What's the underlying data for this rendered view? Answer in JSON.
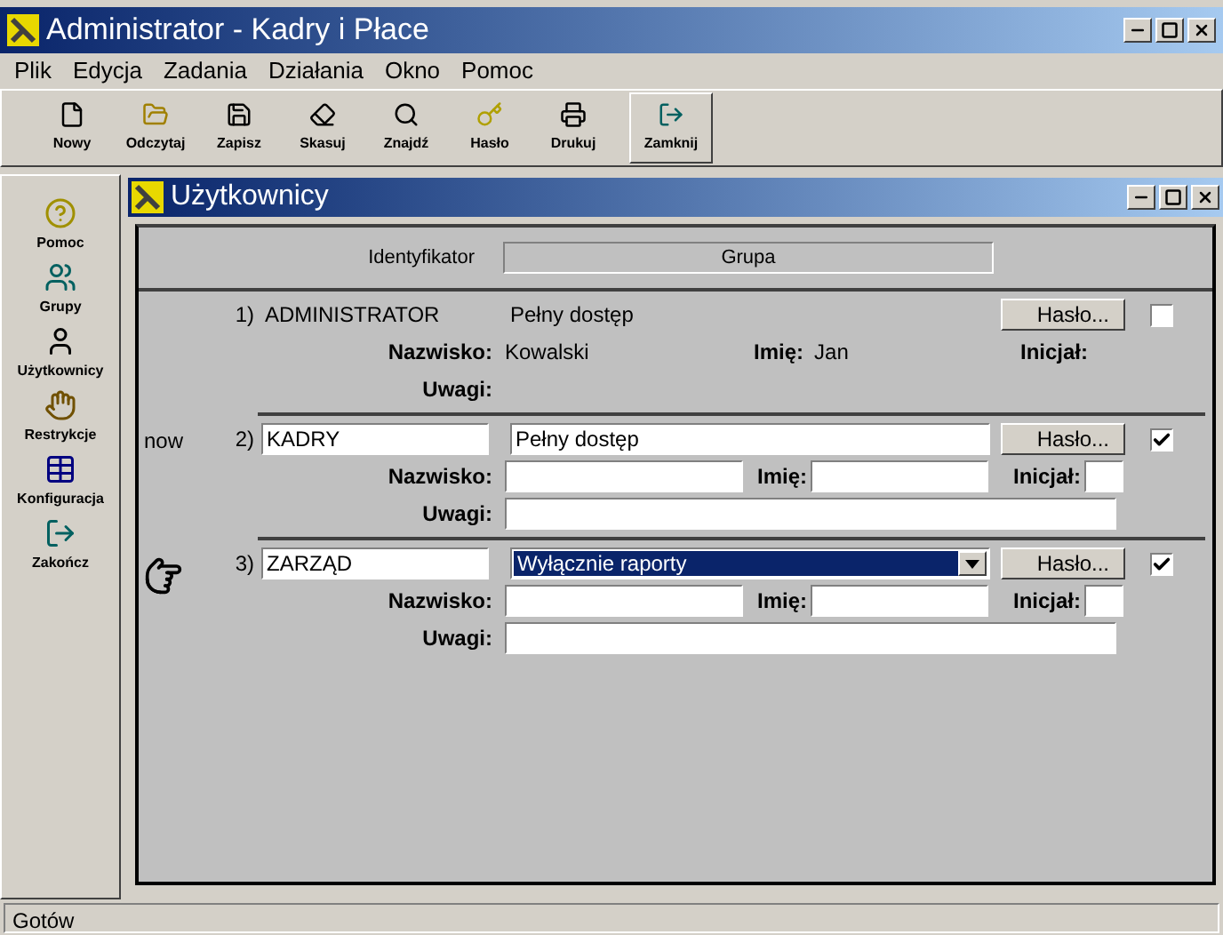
{
  "window": {
    "title": "Administrator - Kadry i Płace"
  },
  "menu": [
    "Plik",
    "Edycja",
    "Zadania",
    "Działania",
    "Okno",
    "Pomoc"
  ],
  "toolbar": [
    {
      "label": "Nowy",
      "kind": "new"
    },
    {
      "label": "Odczytaj",
      "kind": "open"
    },
    {
      "label": "Zapisz",
      "kind": "save"
    },
    {
      "label": "Skasuj",
      "kind": "erase"
    },
    {
      "label": "Znajdź",
      "kind": "find"
    },
    {
      "label": "Hasło",
      "kind": "key"
    },
    {
      "label": "Drukuj",
      "kind": "print"
    },
    {
      "label": "Zamknij",
      "kind": "exit"
    }
  ],
  "sidebar": [
    {
      "label": "Pomoc",
      "kind": "help"
    },
    {
      "label": "Grupy",
      "kind": "groups"
    },
    {
      "label": "Użytkownicy",
      "kind": "users"
    },
    {
      "label": "Restrykcje",
      "kind": "restrict"
    },
    {
      "label": "Konfiguracja",
      "kind": "config"
    },
    {
      "label": "Zakończ",
      "kind": "exit"
    }
  ],
  "child": {
    "title": "Użytkownicy",
    "header": {
      "identifier": "Identyfikator",
      "group": "Grupa"
    },
    "users": [
      {
        "kind": "readonly",
        "current": false,
        "number": "1)",
        "identifier": "ADMINISTRATOR",
        "group": "Pełny dostęp",
        "surname_label": "Nazwisko:",
        "surname": "Kowalski",
        "first_label": "Imię:",
        "first_name": "Jan",
        "initial_label": "Inicjał:",
        "notes_label": "Uwagi:",
        "password_button": "Hasło...",
        "checked": false
      },
      {
        "kind": "edit",
        "marker": "now",
        "current": false,
        "number": "2)",
        "identifier": "KADRY",
        "group": "Pełny dostęp",
        "group_dropdown": false,
        "surname_label": "Nazwisko:",
        "first_label": "Imię:",
        "initial_label": "Inicjał:",
        "notes_label": "Uwagi:",
        "password_button": "Hasło...",
        "checked": true
      },
      {
        "kind": "edit",
        "current": true,
        "number": "3)",
        "identifier": "ZARZĄD",
        "group": "Wyłącznie raporty",
        "group_dropdown": true,
        "surname_label": "Nazwisko:",
        "first_label": "Imię:",
        "initial_label": "Inicjał:",
        "notes_label": "Uwagi:",
        "password_button": "Hasło...",
        "checked": true
      }
    ]
  },
  "status_bar": "Gotów"
}
